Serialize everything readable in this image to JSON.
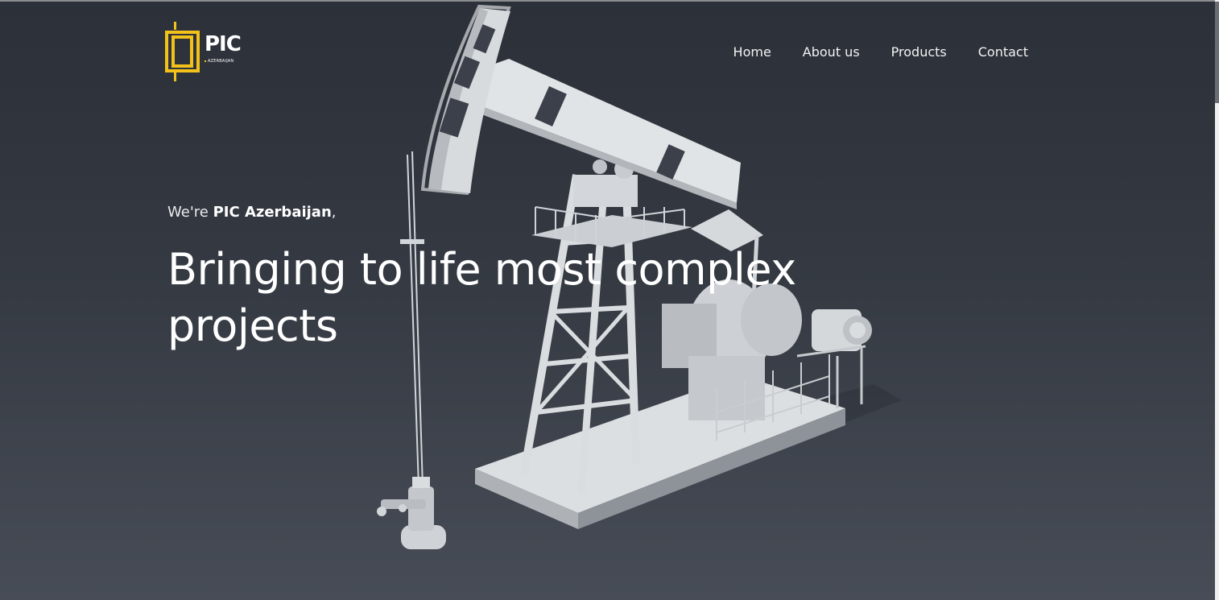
{
  "header": {
    "logo": {
      "word": "PIC",
      "subtitle": "AZERBAIJAN",
      "brand_color": "#f2c21a"
    },
    "nav": {
      "items": [
        {
          "label": "Home"
        },
        {
          "label": "About us"
        },
        {
          "label": "Products"
        },
        {
          "label": "Contact"
        }
      ]
    }
  },
  "hero": {
    "intro_prefix": "We're ",
    "intro_company": "PIC Azerbaijan",
    "intro_suffix": ",",
    "headline": "Bringing to life most complex projects",
    "background_image": "oil-pumpjack-render-icon",
    "background_colors": [
      "#2c3038",
      "#474c56"
    ]
  }
}
